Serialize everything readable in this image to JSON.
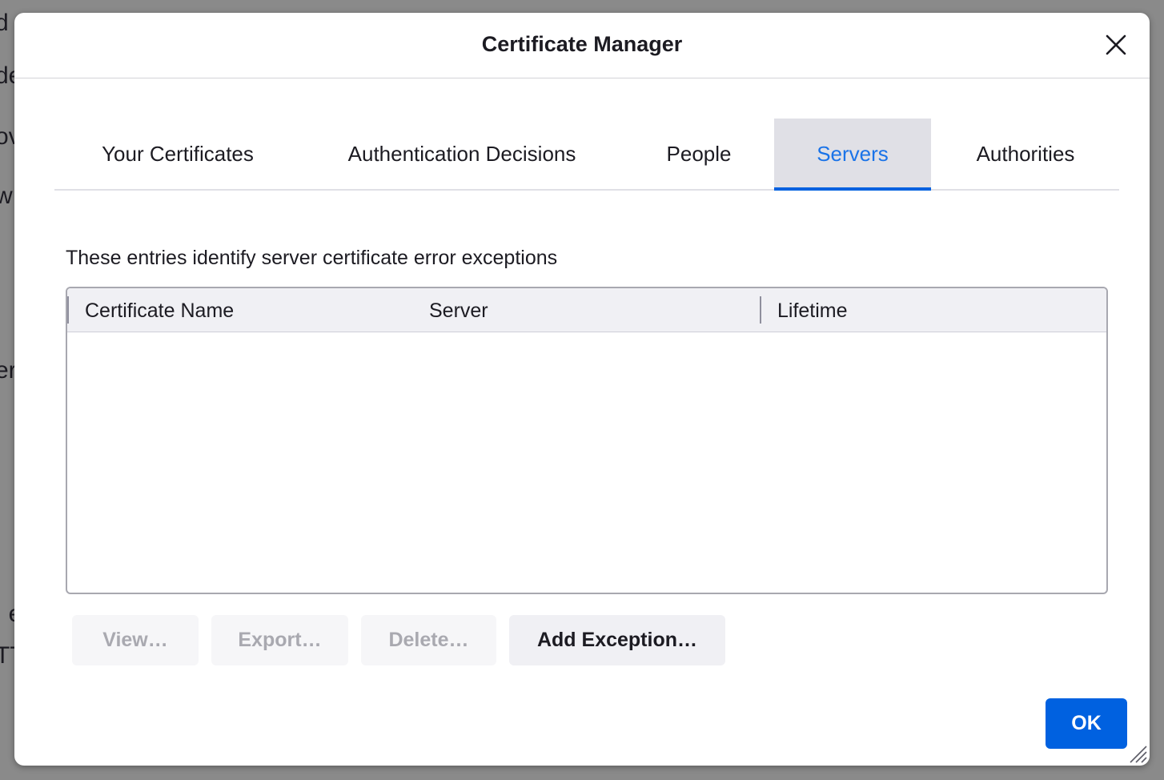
{
  "background_fragments": [
    "d",
    "de",
    "ov",
    "w",
    "er",
    ", e",
    "TT"
  ],
  "dialog": {
    "title": "Certificate Manager",
    "close_icon": "close-icon"
  },
  "tabs": [
    {
      "label": "Your Certificates",
      "selected": false
    },
    {
      "label": "Authentication Decisions",
      "selected": false
    },
    {
      "label": "People",
      "selected": false
    },
    {
      "label": "Servers",
      "selected": true
    },
    {
      "label": "Authorities",
      "selected": false
    }
  ],
  "servers_panel": {
    "description": "These entries identify server certificate error exceptions",
    "columns": [
      "Certificate Name",
      "Server",
      "Lifetime"
    ],
    "rows": []
  },
  "buttons": {
    "view": {
      "label": "View…",
      "enabled": false
    },
    "export": {
      "label": "Export…",
      "enabled": false
    },
    "delete": {
      "label": "Delete…",
      "enabled": false
    },
    "add_exception": {
      "label": "Add Exception…",
      "enabled": true
    },
    "ok": {
      "label": "OK"
    }
  },
  "colors": {
    "accent": "#0061e0",
    "selected_tab_bg": "#e0e0e6",
    "text": "#1c1b22",
    "disabled_text": "#a9a9b0"
  }
}
